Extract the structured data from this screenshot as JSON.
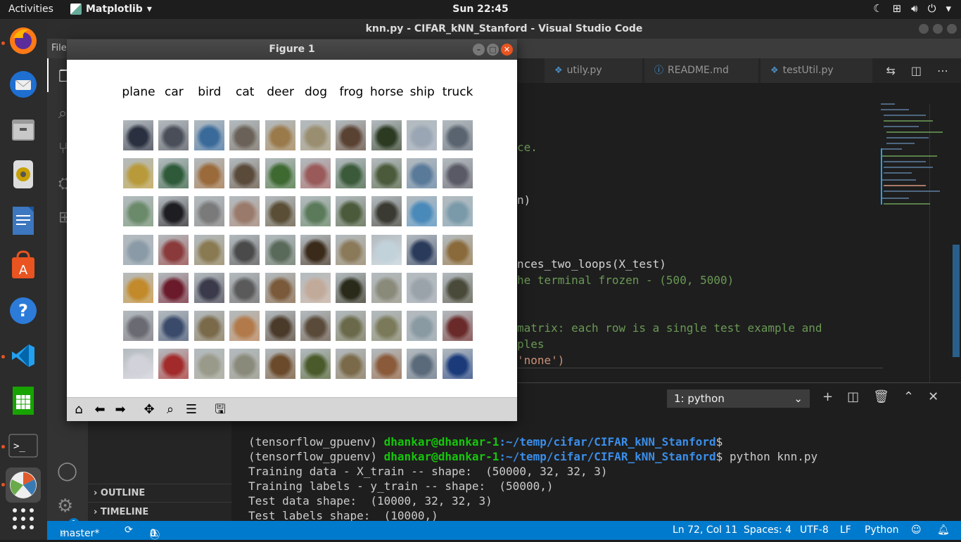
{
  "topbar": {
    "activities": "Activities",
    "app_name": "Matplotlib",
    "app_arrow": "▾",
    "clock": "Sun 22:45",
    "tray_icons": [
      "night-mode-icon",
      "network-icon",
      "volume-icon",
      "power-icon"
    ]
  },
  "dock": {
    "apps": [
      "firefox",
      "thunderbird",
      "files",
      "rhythmbox",
      "writer",
      "software",
      "help",
      "vscode",
      "calc",
      "terminal",
      "matplotlib",
      "show-apps"
    ]
  },
  "vscode": {
    "title": "knn.py - CIFAR_kNN_Stanford - Visual Studio Code",
    "menu_file": "File",
    "tabs": [
      {
        "label": "utily.py",
        "icon": "python-icon"
      },
      {
        "label": "README.md",
        "icon": "info-icon"
      },
      {
        "label": "testUtil.py",
        "icon": "python-icon"
      }
    ],
    "tab_partial": "y",
    "code_lines": [
      "ce.",
      "n)",
      "nces_two_loops(X_test)",
      "he terminal frozen - (500, 5000)",
      "matrix: each row is a single test example and",
      "ples",
      "'none')"
    ],
    "terminal_select": "1: python",
    "terminal_lines": {
      "line1_env": "(tensorflow_gpuenv) ",
      "line1_user": "dhankar@dhankar-1",
      "line1_path": ":~/temp/cifar/CIFAR_kNN_Stanford",
      "line1_tail": "$",
      "line2_env": "(tensorflow_gpuenv) ",
      "line2_user": "dhankar@dhankar-1",
      "line2_path": ":~/temp/cifar/CIFAR_kNN_Stanford",
      "line2_tail": "$ python knn.py",
      "out1": "Training data - X_train -- shape:  (50000, 32, 32, 3)",
      "out2": "Training labels - y_train -- shape:  (50000,)",
      "out3": "Test data shape:  (10000, 32, 32, 3)",
      "out4": "Test labels shape:  (10000,)"
    },
    "sidebar": {
      "outline": "OUTLINE",
      "timeline": "TIMELINE"
    },
    "status": {
      "branch": "master*",
      "errors": "0",
      "warnings": "0",
      "position": "Ln 72, Col 11",
      "spaces": "Spaces: 4",
      "encoding": "UTF-8",
      "eol": "LF",
      "language": "Python",
      "badge": "1"
    }
  },
  "figure": {
    "title": "Figure 1",
    "classes": [
      "plane",
      "car",
      "bird",
      "cat",
      "deer",
      "dog",
      "frog",
      "horse",
      "ship",
      "truck"
    ],
    "rows_per_class": 7,
    "thumb_colors": [
      [
        "#2b3040",
        "#4a4e58",
        "#3a6a9a",
        "#6a6258",
        "#9a7a4a",
        "#9a8e70",
        "#5a4232",
        "#2c3a22",
        "#9aa6b4",
        "#5a6470"
      ],
      [
        "#b89a3a",
        "#2e5a3a",
        "#9a6a3a",
        "#5a4a3a",
        "#3e6a32",
        "#9a5a5a",
        "#3a5a3a",
        "#4a5a3a",
        "#5a7a9a",
        "#5a5a66"
      ],
      [
        "#6a8a6a",
        "#1e1e22",
        "#7a7a7a",
        "#9a7a6a",
        "#5a4e36",
        "#5a7a5a",
        "#4a5a3a",
        "#3a3a32",
        "#4a8aba",
        "#7a9aaa"
      ],
      [
        "#8a9aa6",
        "#8a3a3a",
        "#8a7a52",
        "#4a4a4a",
        "#5a6a5a",
        "#3a2a1a",
        "#8a7a5a",
        "#c2d2da",
        "#2a3a5a",
        "#8a6a3a"
      ],
      [
        "#c28a2a",
        "#6a1a2a",
        "#3a3a4a",
        "#5a5a5a",
        "#7a5a3a",
        "#c2aa9a",
        "#2a2a1a",
        "#8a8a7a",
        "#9aa2aa",
        "#4a4a3a"
      ],
      [
        "#6a6a72",
        "#3a4a6a",
        "#7a6a4a",
        "#b27a4a",
        "#4a3a2a",
        "#5a4a3a",
        "#6a6a4a",
        "#7a7a5a",
        "#8a9aa2",
        "#6a2a2a"
      ],
      [
        "#d2d2da",
        "#a22a2a",
        "#9a9a8a",
        "#8a8a7a",
        "#6a4a2a",
        "#4a5a2a",
        "#7a6a4a",
        "#8a5a3a",
        "#5a6a7a",
        "#1a3a7a"
      ]
    ]
  }
}
